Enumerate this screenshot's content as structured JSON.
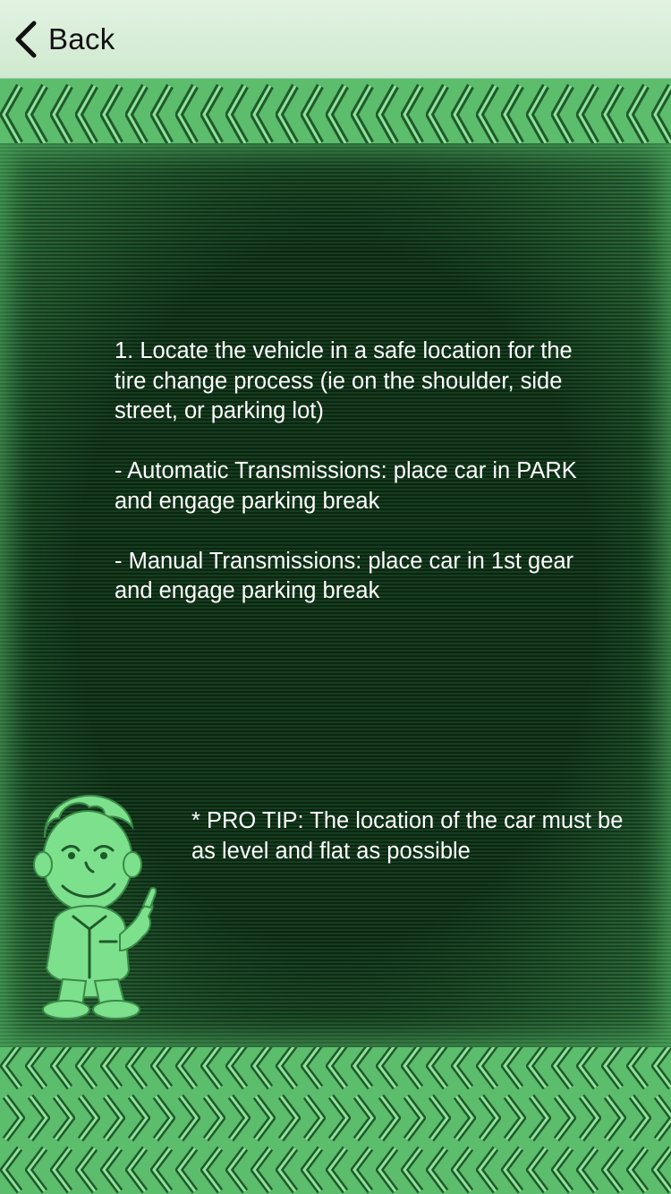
{
  "nav": {
    "back_label": "Back",
    "back_icon": "chevron-left-icon"
  },
  "content": {
    "step": "1. Locate the vehicle in a safe location for the tire change process (ie on the shoulder, side street, or parking lot)",
    "automatic": "- Automatic Transmissions: place car in PARK and engage parking break",
    "manual": "- Manual Transmissions: place car in 1st gear and engage parking break"
  },
  "tip": {
    "text": "* PRO TIP: The location of the car must be as level and flat as possible"
  },
  "colors": {
    "nav_background": "#d8eed8",
    "panel_background": "#0e3417",
    "tread_green": "#5fbf6f",
    "mascot_green": "#7de08c",
    "text": "#ffffff"
  }
}
